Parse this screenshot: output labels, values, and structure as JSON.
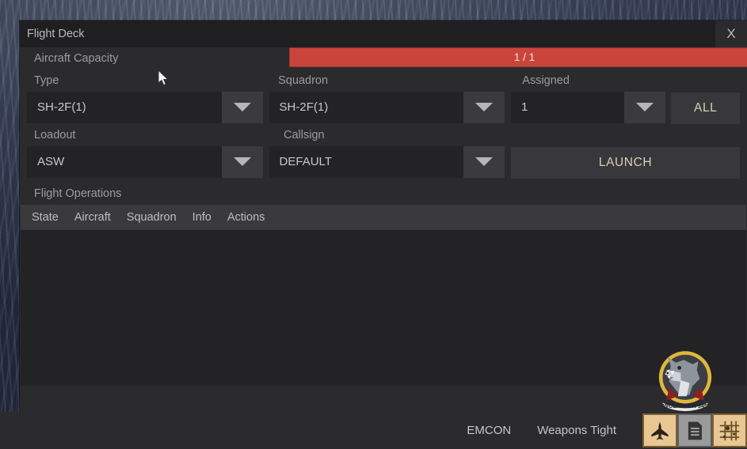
{
  "window": {
    "title": "Flight Deck",
    "close_label": "X"
  },
  "capacity": {
    "label": "Aircraft Capacity",
    "value_text": "1 / 1",
    "current": 1,
    "max": 1,
    "fill_percent": 100,
    "bar_color": "#c9453c"
  },
  "fields": {
    "type": {
      "label": "Type",
      "value": "SH-2F(1)"
    },
    "squadron": {
      "label": "Squadron",
      "value": "SH-2F(1)"
    },
    "assigned": {
      "label": "Assigned",
      "value": "1"
    },
    "loadout": {
      "label": "Loadout",
      "value": "ASW"
    },
    "callsign": {
      "label": "Callsign",
      "value": "DEFAULT"
    }
  },
  "buttons": {
    "all": "ALL",
    "launch": "LAUNCH",
    "accent_color": "#d9cfb6"
  },
  "flight_operations": {
    "title": "Flight Operations",
    "columns": [
      "State",
      "Aircraft",
      "Squadron",
      "Info",
      "Actions"
    ],
    "rows": []
  },
  "patch": {
    "text": "WOLFPACK 345",
    "ring_color": "#e0b73a",
    "icon": "wolf-head-icon"
  },
  "bottom_bar": {
    "emcon_label": "EMCON",
    "weapons_label": "Weapons Tight",
    "icons": [
      {
        "name": "aircraft-icon",
        "active": true
      },
      {
        "name": "document-icon",
        "active": false
      },
      {
        "name": "map-grid-icon",
        "active": true
      }
    ]
  },
  "icons": {
    "dropdown": "chevron-down-icon",
    "cursor": "mouse-cursor-icon"
  }
}
